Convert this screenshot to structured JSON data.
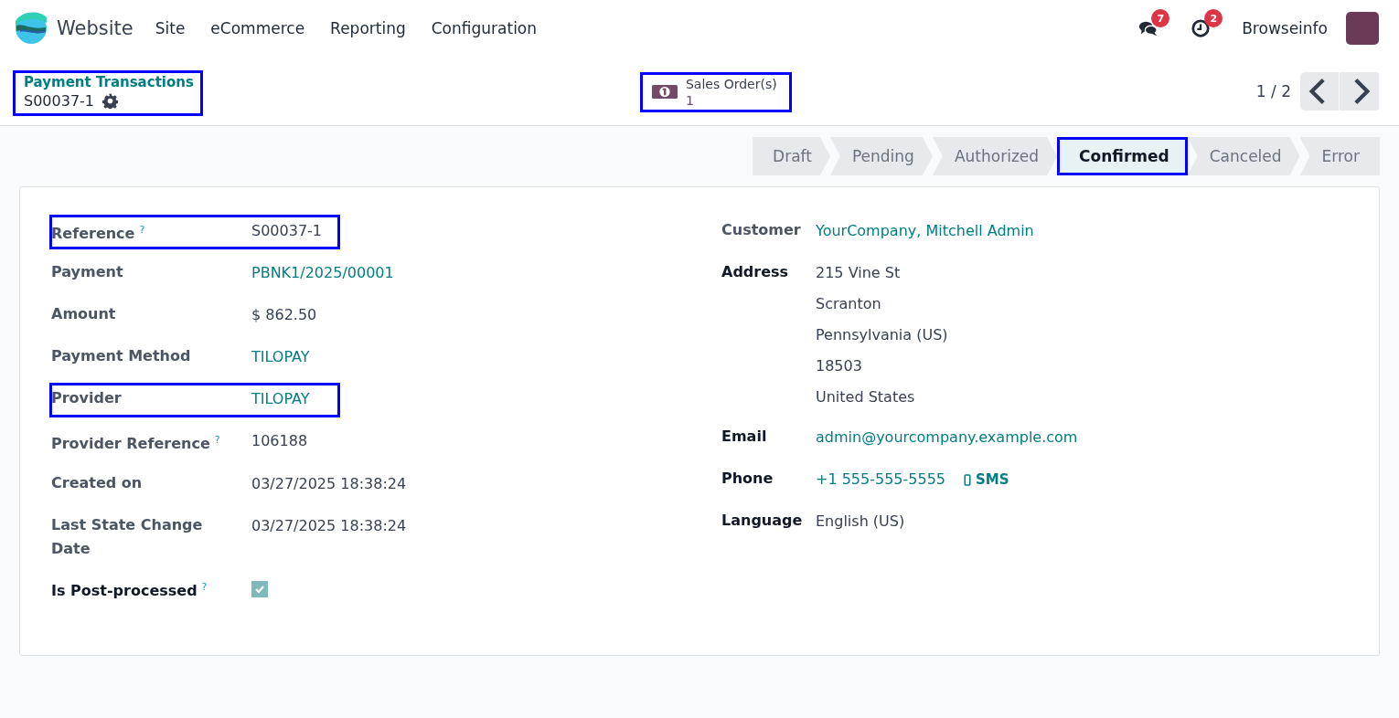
{
  "navbar": {
    "app": "Website",
    "menu": [
      "Site",
      "eCommerce",
      "Reporting",
      "Configuration"
    ],
    "messages_count": "7",
    "activities_count": "2",
    "user": "Browseinfo"
  },
  "breadcrumb": {
    "parent": "Payment Transactions",
    "current": "S00037-1",
    "highlighted": true
  },
  "smart_button": {
    "label": "Sales Order(s)",
    "value": "1",
    "highlighted": true
  },
  "pager": {
    "text": "1 / 2"
  },
  "status_steps": [
    {
      "label": "Draft",
      "selected": false,
      "highlighted": false
    },
    {
      "label": "Pending",
      "selected": false,
      "highlighted": false
    },
    {
      "label": "Authorized",
      "selected": false,
      "highlighted": false
    },
    {
      "label": "Confirmed",
      "selected": true,
      "highlighted": true
    },
    {
      "label": "Canceled",
      "selected": false,
      "highlighted": false
    },
    {
      "label": "Error",
      "selected": false,
      "highlighted": false
    }
  ],
  "left_fields": [
    {
      "label": "Reference",
      "help": "?",
      "kind": "text",
      "value": "S00037-1",
      "readonly": true,
      "highlighted": true
    },
    {
      "label": "Payment",
      "kind": "link",
      "value": "PBNK1/2025/00001",
      "readonly": true,
      "highlighted": false
    },
    {
      "label": "Amount",
      "kind": "text",
      "value": "$ 862.50",
      "readonly": true,
      "highlighted": false
    },
    {
      "label": "Payment Method",
      "kind": "link",
      "value": "TILOPAY",
      "readonly": true,
      "highlighted": false
    },
    {
      "label": "Provider",
      "kind": "link",
      "value": "TILOPAY",
      "readonly": true,
      "highlighted": true
    },
    {
      "label": "Provider Reference",
      "help": "?",
      "kind": "text",
      "value": "106188",
      "readonly": true,
      "highlighted": false
    },
    {
      "label": "Created on",
      "kind": "text",
      "value": "03/27/2025 18:38:24",
      "readonly": true,
      "highlighted": false
    },
    {
      "label": "Last State Change Date",
      "kind": "text",
      "value": "03/27/2025 18:38:24",
      "readonly": true,
      "highlighted": false
    },
    {
      "label": "Is Post-processed",
      "help": "?",
      "kind": "checkbox",
      "checked": true,
      "readonly": false,
      "highlighted": false
    }
  ],
  "right_fields": [
    {
      "label": "Customer",
      "kind": "link",
      "value": "YourCompany, Mitchell Admin",
      "readonly": true,
      "highlighted": false
    },
    {
      "label": "Address",
      "kind": "address",
      "lines": [
        "215 Vine St",
        "Scranton",
        "Pennsylvania (US)",
        "18503",
        "United States"
      ],
      "readonly": false,
      "highlighted": false
    },
    {
      "label": "Email",
      "kind": "link",
      "value": "admin@yourcompany.example.com",
      "readonly": false,
      "highlighted": false
    },
    {
      "label": "Phone",
      "kind": "phone",
      "value": "+1 555-555-5555",
      "action": "SMS",
      "readonly": false,
      "highlighted": false
    },
    {
      "label": "Language",
      "kind": "text",
      "value": "English (US)",
      "readonly": false,
      "highlighted": false
    }
  ]
}
